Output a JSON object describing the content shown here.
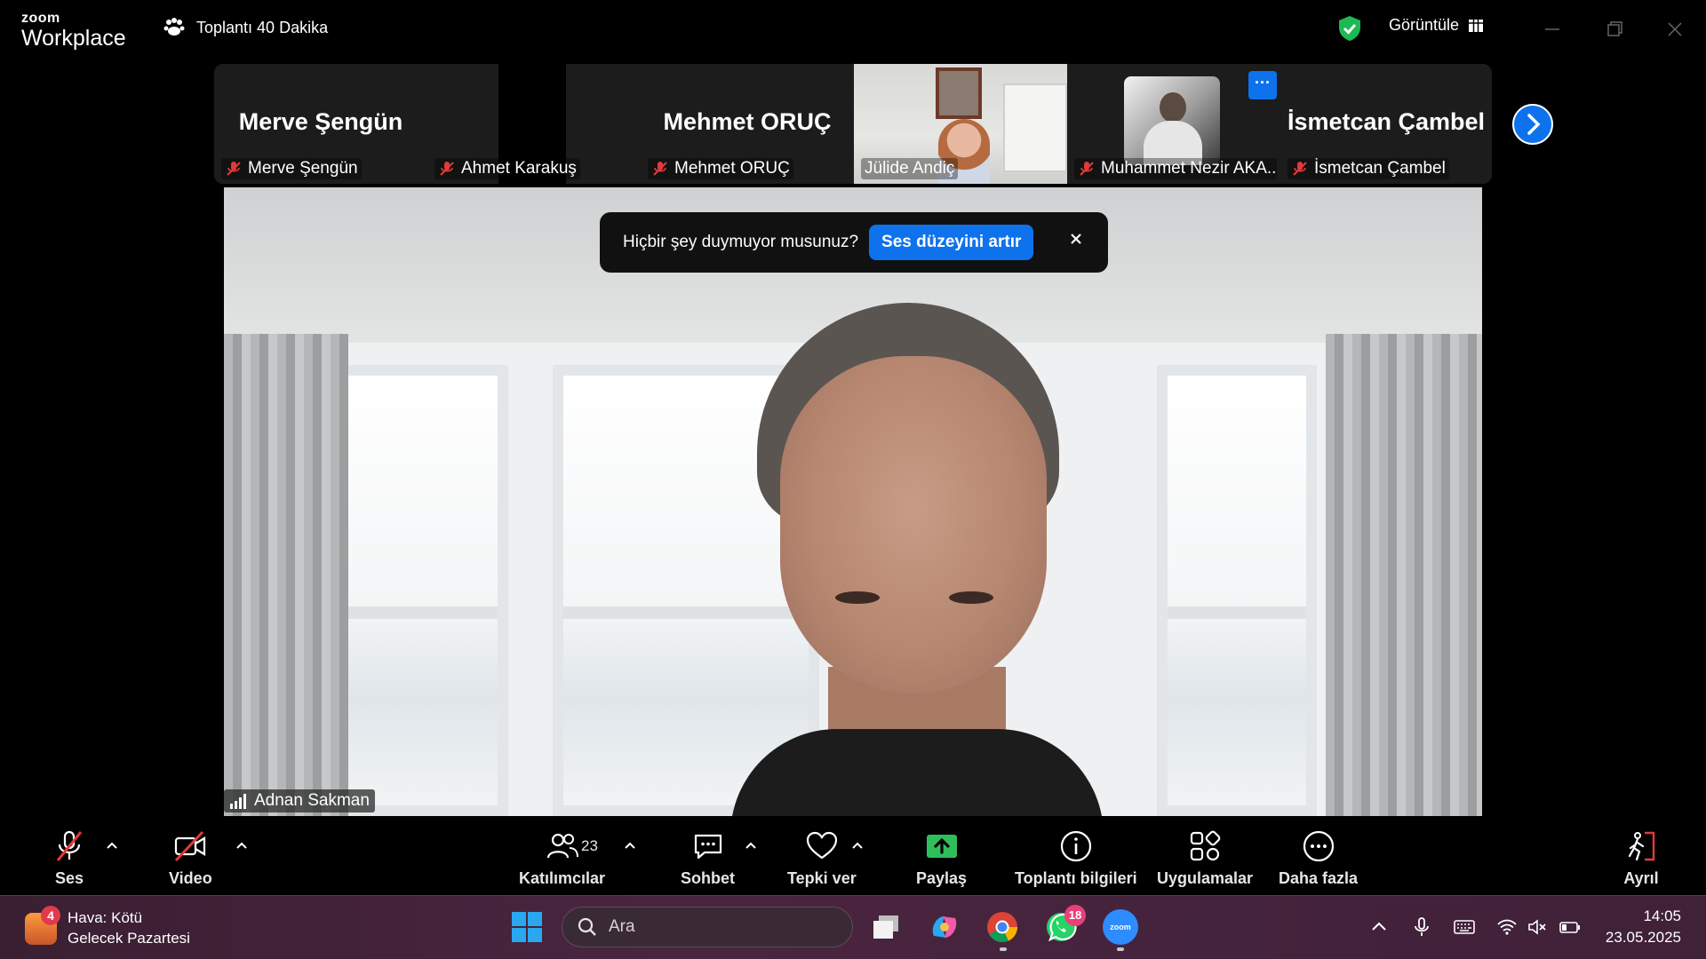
{
  "app": {
    "logo_small": "zoom",
    "logo_big": "Workplace",
    "meeting_timer": "Toplantı 40 Dakika",
    "view_label": "Görüntüle"
  },
  "gallery": {
    "tiles": [
      {
        "big_name": "Merve Şengün",
        "label": "Merve Şengün",
        "muted": true
      },
      {
        "big_name": "",
        "label": "Ahmet Karakuş",
        "muted": true
      },
      {
        "big_name": "Mehmet ORUÇ",
        "label": "Mehmet ORUÇ",
        "muted": true
      },
      {
        "big_name": "",
        "label": "Jülide Andiç",
        "muted": false
      },
      {
        "big_name": "",
        "label": "Muhammet Nezir AKA...",
        "muted": true
      },
      {
        "big_name": "İsmetcan Çambel",
        "label": "İsmetcan Çambel",
        "muted": true
      }
    ],
    "more_label": "···"
  },
  "main_video": {
    "speaker": "Adnan Sakman"
  },
  "toast": {
    "message": "Hiçbir şey duymuyor musunuz?",
    "action": "Ses düzeyini artır",
    "close": "×"
  },
  "toolbar": {
    "audio": "Ses",
    "video": "Video",
    "participants": "Katılımcılar",
    "participants_count": "23",
    "chat": "Sohbet",
    "react": "Tepki ver",
    "share": "Paylaş",
    "meeting_info": "Toplantı bilgileri",
    "apps": "Uygulamalar",
    "more": "Daha fazla",
    "leave": "Ayrıl"
  },
  "taskbar": {
    "weather_badge": "4",
    "weather_title": "Hava: Kötü",
    "weather_sub": "Gelecek Pazartesi",
    "search_placeholder": "Ara",
    "whatsapp_badge": "18",
    "zoom_icon_text": "zoom",
    "time": "14:05",
    "date": "23.05.2025"
  },
  "colors": {
    "accent": "#0e72ed",
    "share_green": "#2fbf5a",
    "leave_red": "#e23a3a",
    "shield_green": "#1db954"
  }
}
